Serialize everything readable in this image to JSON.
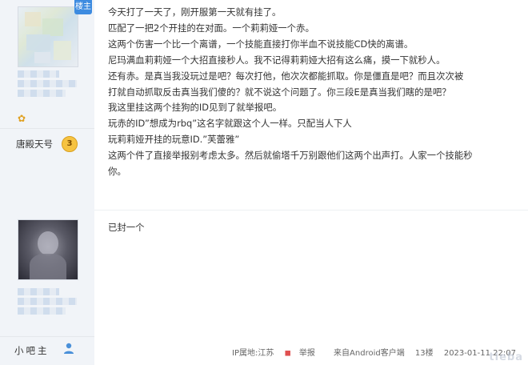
{
  "post": {
    "badge": "楼主",
    "rank_label": "唐殿天号",
    "rank_level": "3",
    "lines": [
      "今天打了一天了，刚开服第一天就有挂了。",
      "匹配了一把2个开挂的在对面。一个莉莉娅一个赤。",
      "这两个伤害一个比一个离谱，一个技能直接打你半血不说技能CD快的离谱。",
      "尼玛满血莉莉娅一个大招直接秒人。我不记得莉莉娅大招有这么痛，摸一下就秒人。",
      "还有赤。是真当我没玩过是吧？每次打他，他次次都能抓取。你是僵直是吧？而且次次被",
      "打就自动抓取反击真当我们傻的？就不说这个问题了。你三段E是真当我们瞎的是吧？",
      "我这里挂这两个挂狗的ID见到了就举报吧。",
      "玩赤的ID”想成为rbq”这名字就跟这个人一样。只配当人下人",
      "玩莉莉娅开挂的玩意ID.”芙蕾雅”",
      "这两个件了直接举报别考虑太多。然后就偷塔千万别跟他们这两个出声打。人家一个技能秒",
      "你。"
    ]
  },
  "reply": {
    "rank_label": "小吧主",
    "text": "已封一个",
    "footer": {
      "ip": "IP属地:江苏",
      "report": "举报",
      "source": "来自Android客户端",
      "floor": "13楼",
      "time": "2023-01-11 22:07"
    }
  },
  "watermark": "tieba",
  "icons": {
    "small": "flower-icon",
    "report": "report-icon",
    "user": "user-icon"
  },
  "colors": {
    "sidebar_bg": "#f1f4f8",
    "badge_bg": "#3d8be0",
    "report": "#e05050"
  }
}
